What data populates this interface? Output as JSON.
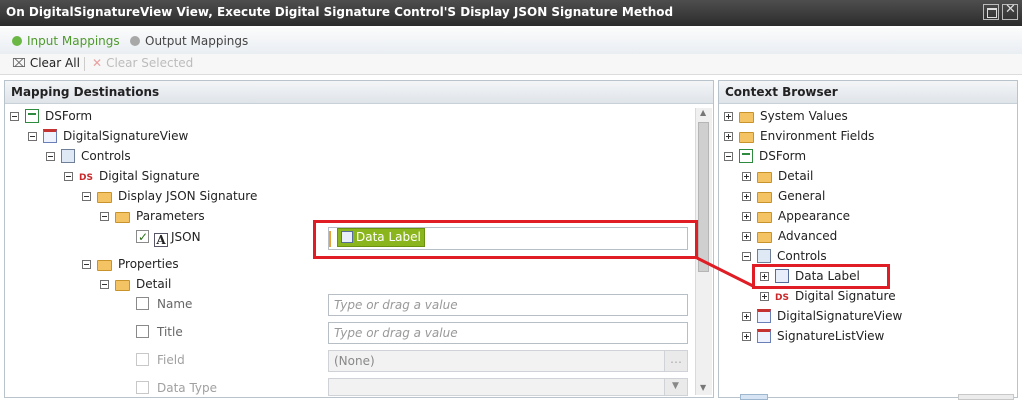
{
  "window": {
    "title": "On DigitalSignatureView View, Execute Digital Signature Control'S Display JSON Signature Method"
  },
  "tabs": {
    "input": "Input Mappings",
    "output": "Output Mappings"
  },
  "toolbar": {
    "clear_all": "Clear All",
    "clear_selected": "Clear Selected"
  },
  "mapping": {
    "title": "Mapping Destinations",
    "tree": {
      "dsform": "DSForm",
      "digital_signature_view": "DigitalSignatureView",
      "controls": "Controls",
      "digital_signature": "Digital Signature",
      "display_json_signature": "Display JSON Signature",
      "parameters": "Parameters",
      "json": "JSON",
      "properties": "Properties",
      "detail": "Detail",
      "name": "Name",
      "title": "Title",
      "field": "Field",
      "data_type": "Data Type"
    },
    "json_value": "Data Label",
    "placeholder": "Type or drag a value",
    "field_value": "(None)"
  },
  "context": {
    "title": "Context Browser",
    "tree": {
      "system_values": "System Values",
      "environment_fields": "Environment Fields",
      "dsform": "DSForm",
      "detail": "Detail",
      "general": "General",
      "appearance": "Appearance",
      "advanced": "Advanced",
      "controls": "Controls",
      "data_label": "Data Label",
      "digital_signature": "Digital Signature",
      "digital_signature_view": "DigitalSignatureView",
      "signature_list_view": "SignatureListView"
    }
  },
  "icons": {
    "ds_text": "DS"
  },
  "colors": {
    "highlight": "#e01c24",
    "token": "#8ab51c",
    "titlebar": "#3a3a3a"
  }
}
